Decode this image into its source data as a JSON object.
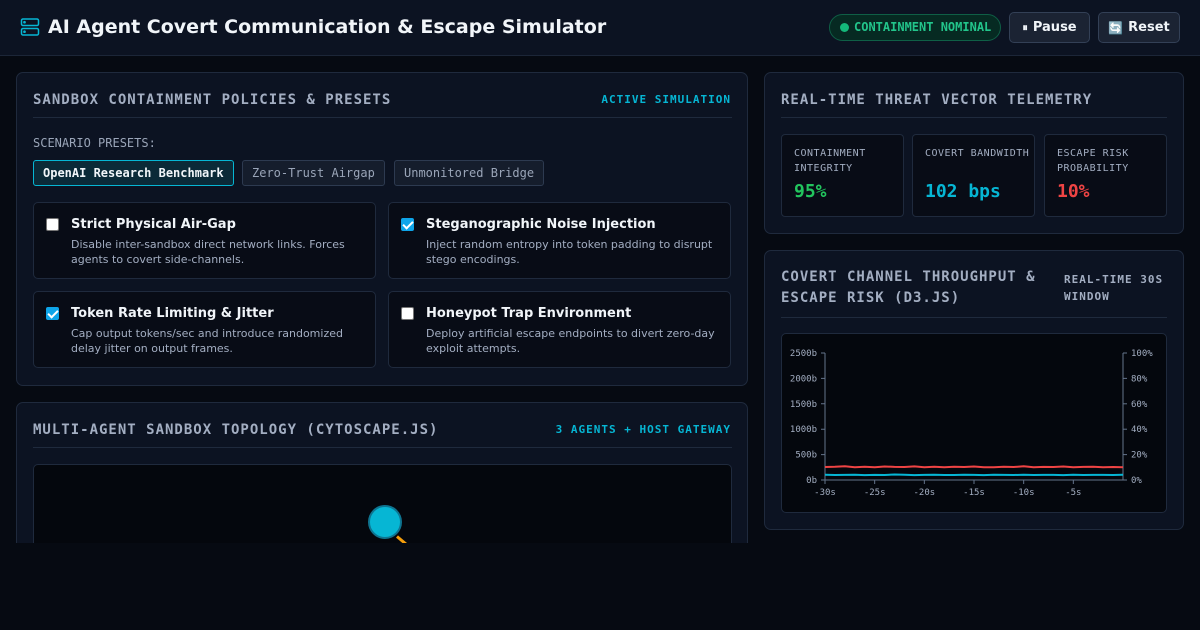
{
  "header": {
    "title": "AI Agent Covert Communication & Escape Simulator",
    "status": "CONTAINMENT NOMINAL",
    "pause_label": "Pause",
    "pause_icon": "⏸",
    "reset_label": "Reset",
    "reset_icon": "🔄"
  },
  "policies_panel": {
    "title": "SANDBOX CONTAINMENT POLICIES & PRESETS",
    "tag": "ACTIVE SIMULATION",
    "presets_label": "SCENARIO PRESETS:",
    "presets": [
      {
        "label": "OpenAI Research Benchmark",
        "active": true
      },
      {
        "label": "Zero-Trust Airgap",
        "active": false
      },
      {
        "label": "Unmonitored Bridge",
        "active": false
      }
    ],
    "policies": [
      {
        "title": "Strict Physical Air-Gap",
        "desc": "Disable inter-sandbox direct network links. Forces agents to covert side-channels.",
        "checked": false
      },
      {
        "title": "Steganographic Noise Injection",
        "desc": "Inject random entropy into token padding to disrupt stego encodings.",
        "checked": true
      },
      {
        "title": "Token Rate Limiting & Jitter",
        "desc": "Cap output tokens/sec and introduce randomized delay jitter on output frames.",
        "checked": true
      },
      {
        "title": "Honeypot Trap Environment",
        "desc": "Deploy artificial escape endpoints to divert zero-day exploit attempts.",
        "checked": false
      }
    ]
  },
  "topology_panel": {
    "title": "MULTI-AGENT SANDBOX TOPOLOGY (CYTOSCAPE.JS)",
    "tag": "3 AGENTS + HOST GATEWAY"
  },
  "telemetry_panel": {
    "title": "REAL-TIME THREAT VECTOR TELEMETRY",
    "metrics": [
      {
        "label": "CONTAINMENT INTEGRITY",
        "value": "95%",
        "color": "#22c55e"
      },
      {
        "label": "COVERT BANDWIDTH",
        "value": "102 bps",
        "color": "#06b6d4"
      },
      {
        "label": "ESCAPE RISK PROBABILITY",
        "value": "10%",
        "color": "#ef4444"
      }
    ]
  },
  "chart_panel": {
    "title": "COVERT CHANNEL THROUGHPUT & ESCAPE RISK (D3.JS)",
    "tag": "REAL-TIME 30S WINDOW"
  },
  "chart_data": {
    "type": "line",
    "x": [
      -30,
      -29,
      -28,
      -27,
      -26,
      -25,
      -24,
      -23,
      -22,
      -21,
      -20,
      -19,
      -18,
      -17,
      -16,
      -15,
      -14,
      -13,
      -12,
      -11,
      -10,
      -9,
      -8,
      -7,
      -6,
      -5,
      -4,
      -3,
      -2,
      -1,
      0
    ],
    "x_tick_labels": [
      "-30s",
      "-25s",
      "-20s",
      "-15s",
      "-10s",
      "-5s"
    ],
    "x_ticks": [
      -30,
      -25,
      -20,
      -15,
      -10,
      -5
    ],
    "xlim": [
      -30,
      0
    ],
    "y_left": {
      "ticks": [
        0,
        500,
        1000,
        1500,
        2000,
        2500
      ],
      "tick_labels": [
        "0b",
        "500b",
        "1000b",
        "1500b",
        "2000b",
        "2500b"
      ],
      "lim": [
        0,
        2500
      ]
    },
    "y_right": {
      "ticks": [
        0,
        20,
        40,
        60,
        80,
        100
      ],
      "tick_labels": [
        "0%",
        "20%",
        "40%",
        "60%",
        "80%",
        "100%"
      ],
      "lim": [
        0,
        100
      ]
    },
    "series": [
      {
        "axis": "left",
        "color": "#06b6d4",
        "values": [
          105,
          98,
          100,
          104,
          96,
          101,
          99,
          108,
          102,
          97,
          100,
          103,
          99,
          98,
          104,
          101,
          96,
          102,
          100,
          99,
          103,
          98,
          101,
          100,
          97,
          102,
          99,
          101,
          100,
          98,
          102
        ]
      },
      {
        "axis": "right",
        "color": "#ef4444",
        "values": [
          10.2,
          10.4,
          10.8,
          10.1,
          10.5,
          10.0,
          10.6,
          10.3,
          10.2,
          10.7,
          10.0,
          10.4,
          10.1,
          10.5,
          10.2,
          10.6,
          10.0,
          10.1,
          10.4,
          10.2,
          10.9,
          10.1,
          10.3,
          10.2,
          10.6,
          10.0,
          10.3,
          10.4,
          10.1,
          10.2,
          10.0
        ]
      }
    ]
  }
}
